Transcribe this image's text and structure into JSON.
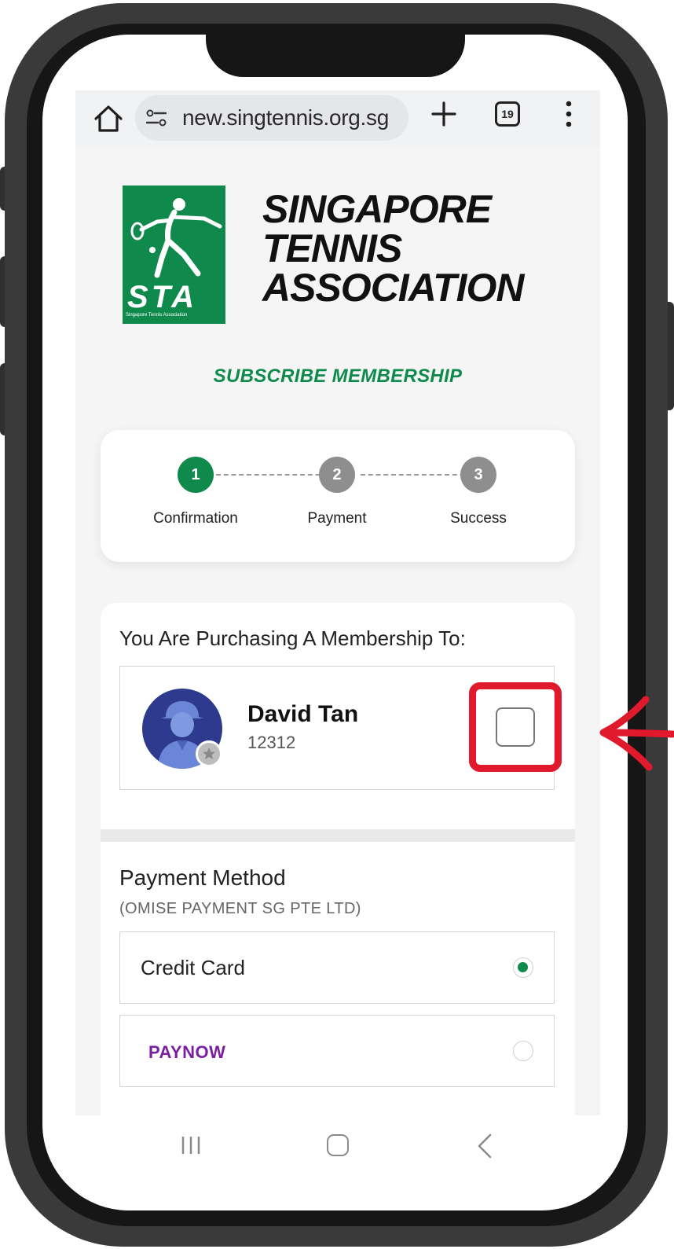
{
  "browser": {
    "url": "new.singtennis.org.sg",
    "tab_count": "19",
    "icons": [
      "home-icon",
      "site-settings-icon",
      "new-tab-plus-icon",
      "tabs-counter-icon",
      "more-options-icon"
    ]
  },
  "brand": {
    "logo_text": "STA",
    "logo_subtext": "Singapore Tennis Association",
    "name_line1": "SINGAPORE",
    "name_line2": "TENNIS",
    "name_line3": "ASSOCIATION",
    "primary_color": "#0f8a4c"
  },
  "page_title": "SUBSCRIBE MEMBERSHIP",
  "stepper": {
    "steps": [
      {
        "number": "1",
        "label": "Confirmation",
        "state": "active"
      },
      {
        "number": "2",
        "label": "Payment",
        "state": "inactive"
      },
      {
        "number": "3",
        "label": "Success",
        "state": "inactive"
      }
    ]
  },
  "purchase": {
    "title": "You Are Purchasing A Membership To:",
    "member": {
      "name": "David Tan",
      "id": "12312",
      "selected": false
    }
  },
  "payment": {
    "title": "Payment Method",
    "provider": "(OMISE PAYMENT SG PTE LTD)",
    "options": [
      {
        "label": "Credit Card",
        "selected": true
      },
      {
        "label": "PAYNOW",
        "selected": false
      }
    ]
  },
  "annotation": {
    "highlight_color": "#e0192d",
    "target": "member-checkbox"
  }
}
